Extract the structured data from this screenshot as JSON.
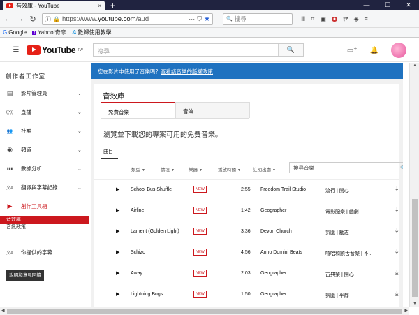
{
  "browser": {
    "tab_title": "音效庫 - YouTube",
    "tab_close": "×",
    "new_tab": "+",
    "window_controls": [
      "—",
      "☐",
      "✕"
    ],
    "url_prefix": "https://www.",
    "url_domain": "youtube.com",
    "url_rest": "/aud",
    "search_placeholder": "搜尋",
    "search_icon": "🔍",
    "bookmarks": [
      {
        "icon": "G",
        "label": "Google"
      },
      {
        "icon": "Y",
        "label": "Yahoo!奇摩"
      },
      {
        "icon": "✲",
        "label": "數歸使用教學"
      }
    ]
  },
  "youtube": {
    "logo_text": "YouTube",
    "logo_sup": "TW",
    "search_placeholder": "搜尋"
  },
  "sidebar": {
    "title": "創作者工作室",
    "items": [
      {
        "icon": "▤",
        "label": "影片管理員",
        "chevron": "⌄"
      },
      {
        "icon": "((•))",
        "label": "直播",
        "chevron": "⌄"
      },
      {
        "icon": "👥",
        "label": "社群",
        "chevron": "⌄"
      },
      {
        "icon": "◉",
        "label": "頻道",
        "chevron": "⌄"
      },
      {
        "icon": "▮▮▮",
        "label": "數據分析",
        "chevron": "⌄"
      },
      {
        "icon": "文A",
        "label": "翻譯與字幕記錄",
        "chevron": "⌄"
      }
    ],
    "create_item": {
      "icon": "▶",
      "label": "創作工具箱"
    },
    "sub_items": [
      "音效庫",
      "音訊政策"
    ],
    "your_subtitles": {
      "icon": "文A",
      "label": "你提供的字幕"
    },
    "feedback_button": "說明和意見回饋"
  },
  "main": {
    "notice_text": "您在影片中使用了音樂嗎？",
    "notice_link": "查看該音樂的版權政策",
    "card_title": "音效庫",
    "tabs": [
      "免費音樂",
      "音效"
    ],
    "browse_text": "瀏覽並下載您的專案可用的免費音樂。",
    "subtab": "曲目",
    "filters": [
      "類型",
      "情境",
      "樂器",
      "播放時間",
      "註明出處"
    ],
    "search_placeholder": "搜尋音樂",
    "new_badge": "NEW",
    "tracks": [
      {
        "title": "School Bus Shuffle",
        "duration": "2:55",
        "artist": "Freedom Trail Studio",
        "genre": "流行 | 開心"
      },
      {
        "title": "Airline",
        "duration": "1:42",
        "artist": "Geographer",
        "genre": "電影配樂 | 戲劇"
      },
      {
        "title": "Lament (Golden Light)",
        "duration": "3:36",
        "artist": "Devon Church",
        "genre": "氛圍 | 勵志"
      },
      {
        "title": "Schizo",
        "duration": "4:56",
        "artist": "Anno Domini Beats",
        "genre": "嘻哈和饒舌音樂 | 不..."
      },
      {
        "title": "Away",
        "duration": "2:03",
        "artist": "Geographer",
        "genre": "古典樂 | 開心"
      },
      {
        "title": "Lightning Bugs",
        "duration": "1:50",
        "artist": "Geographer",
        "genre": "氛圍 | 平靜"
      }
    ]
  }
}
